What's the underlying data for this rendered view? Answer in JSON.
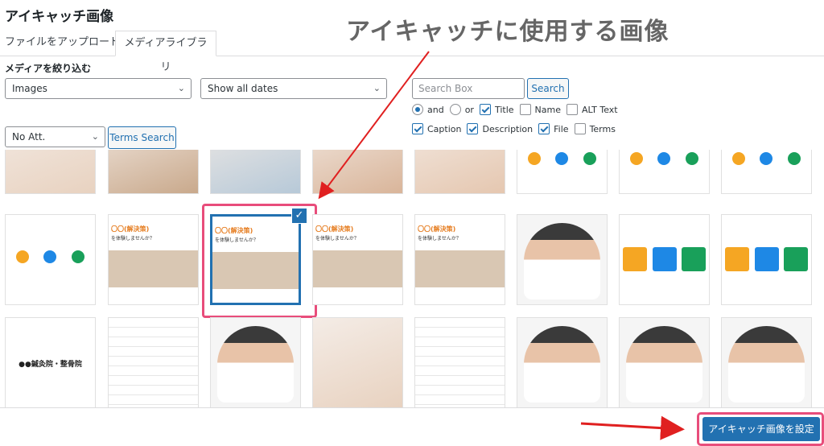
{
  "modal": {
    "title": "アイキャッチ画像"
  },
  "tabs": [
    {
      "label": "ファイルをアップロード",
      "active": false
    },
    {
      "label": "メディアライブラリ",
      "active": true
    }
  ],
  "filter": {
    "heading": "メディアを絞り込む",
    "type_select": "Images",
    "date_select": "Show all dates",
    "category_select": "No Att. Categories",
    "terms_search_label": "Terms Search",
    "search_placeholder": "Search Box",
    "search_button": "Search",
    "options_row1": [
      {
        "kind": "radio",
        "label": "and",
        "checked": true
      },
      {
        "kind": "radio",
        "label": "or",
        "checked": false
      },
      {
        "kind": "check",
        "label": "Title",
        "checked": true
      },
      {
        "kind": "check",
        "label": "Name",
        "checked": false
      },
      {
        "kind": "check",
        "label": "ALT Text",
        "checked": false
      }
    ],
    "options_row2": [
      {
        "kind": "check",
        "label": "Caption",
        "checked": true
      },
      {
        "kind": "check",
        "label": "Description",
        "checked": true
      },
      {
        "kind": "check",
        "label": "File",
        "checked": true
      },
      {
        "kind": "check",
        "label": "Terms",
        "checked": false
      }
    ]
  },
  "annotation": {
    "text": "アイキャッチに使用する画像"
  },
  "grid": {
    "rows": [
      [
        "photo",
        "photo",
        "photo",
        "photo",
        "photo",
        "icons",
        "icons",
        "icons"
      ],
      [
        "icons",
        "banner",
        "banner-selected",
        "banner",
        "banner",
        "person",
        "color-buttons",
        "color-buttons"
      ],
      [
        "clinic-text",
        "chart",
        "person",
        "photo",
        "chart",
        "person",
        "person",
        "person"
      ]
    ],
    "selected_check": "✓",
    "banner_title": "〇〇(解決策)",
    "banner_sub": "を体験しませんか？",
    "clinic_label": "●●鍼灸院・整骨院",
    "colors": {
      "orange": "#f5a623",
      "blue": "#1e88e5",
      "green": "#19a05a"
    }
  },
  "footer": {
    "set_button": "アイキャッチ画像を設定"
  },
  "accent": "#2271b1",
  "highlight": "#e84d7b",
  "arrow_color": "#e02020"
}
